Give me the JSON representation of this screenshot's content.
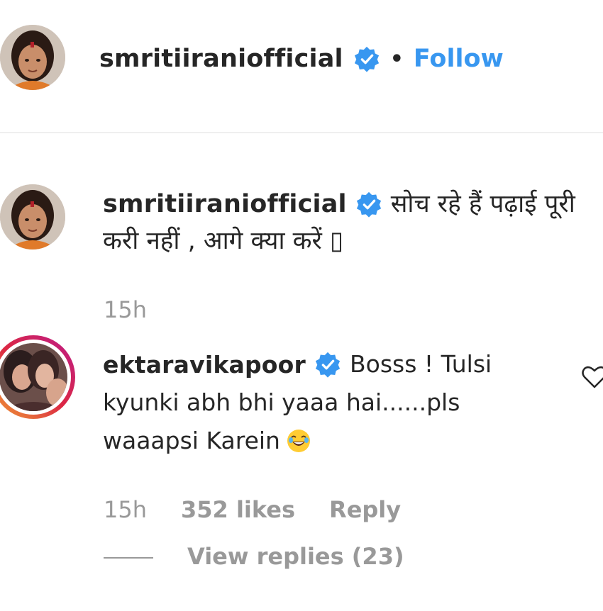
{
  "header": {
    "username": "smritiiraniofficial",
    "separator": "•",
    "follow_label": "Follow"
  },
  "caption": {
    "username": "smritiiraniofficial",
    "text_line1": "सोच रहे हैं पढ़ाई पूरी",
    "text_line2": "करी नहीं , आगे क्या करें ▯",
    "time": "15h"
  },
  "comment": {
    "username": "ektaravikapoor",
    "text_line1": "Bosss ! Tulsi",
    "text_line2": "kyunki abh bhi yaaa hai......pls",
    "text_line3": "waaapsi Karein",
    "emoji": "😂",
    "time": "15h",
    "likes": "352 likes",
    "reply_label": "Reply",
    "view_replies_label": "View replies (23)"
  },
  "colors": {
    "link_blue": "#3897f0",
    "verified_blue": "#3897f0",
    "text_primary": "#262626",
    "text_muted": "#999999",
    "divider": "#efefef"
  },
  "icons": {
    "verified": "verified-badge-icon",
    "like": "heart-outline-icon"
  }
}
